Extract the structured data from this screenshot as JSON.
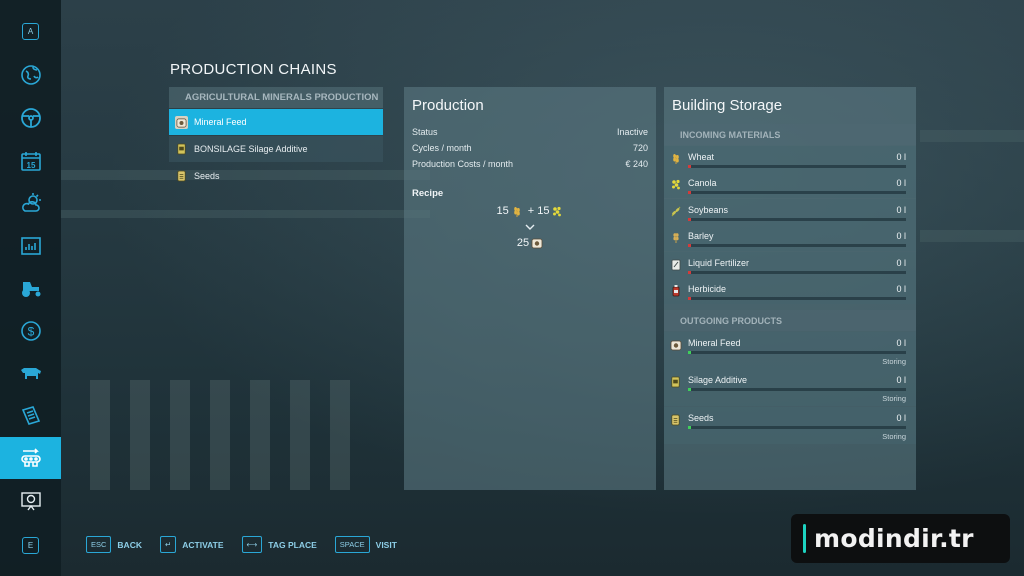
{
  "page": {
    "title": "PRODUCTION CHAINS"
  },
  "sidebar": {
    "top_key": "A",
    "bottom_key": "E",
    "items": [
      {
        "icon": "globe-icon"
      },
      {
        "icon": "steering-wheel-icon"
      },
      {
        "icon": "calendar-icon",
        "label": "15"
      },
      {
        "icon": "weather-icon"
      },
      {
        "icon": "statistics-icon"
      },
      {
        "icon": "tractor-icon"
      },
      {
        "icon": "finances-icon"
      },
      {
        "icon": "animals-icon"
      },
      {
        "icon": "contracts-icon"
      },
      {
        "icon": "production-chains-icon"
      },
      {
        "icon": "help-icon"
      }
    ]
  },
  "production_list": {
    "header": "AGRICULTURAL MINERALS PRODUCTION",
    "items": [
      {
        "label": "Mineral Feed",
        "icon": "mineral-feed-icon"
      },
      {
        "label": "BONSILAGE Silage Additive",
        "icon": "silage-additive-icon"
      },
      {
        "label": "Seeds",
        "icon": "seeds-icon"
      }
    ]
  },
  "production": {
    "title": "Production",
    "status_label": "Status",
    "status_value": "Inactive",
    "cycles_label": "Cycles / month",
    "cycles_value": "720",
    "costs_label": "Production Costs / month",
    "costs_value": "€ 240",
    "recipe_label": "Recipe",
    "recipe": {
      "input1_qty": "15",
      "input1_icon": "wheat-icon",
      "plus": "+",
      "input2_qty": "15",
      "input2_icon": "canola-icon",
      "output_qty": "25",
      "output_icon": "mineral-feed-icon"
    }
  },
  "storage": {
    "title": "Building Storage",
    "incoming_label": "INCOMING MATERIALS",
    "incoming": [
      {
        "name": "Wheat",
        "amount": "0 l",
        "icon": "wheat-icon",
        "fill": 0
      },
      {
        "name": "Canola",
        "amount": "0 l",
        "icon": "canola-icon",
        "fill": 0
      },
      {
        "name": "Soybeans",
        "amount": "0 l",
        "icon": "soybeans-icon",
        "fill": 0
      },
      {
        "name": "Barley",
        "amount": "0 l",
        "icon": "barley-icon",
        "fill": 0
      },
      {
        "name": "Liquid Fertilizer",
        "amount": "0 l",
        "icon": "liquid-fertilizer-icon",
        "fill": 0
      },
      {
        "name": "Herbicide",
        "amount": "0 l",
        "icon": "herbicide-icon",
        "fill": 0
      }
    ],
    "outgoing_label": "OUTGOING PRODUCTS",
    "outgoing": [
      {
        "name": "Mineral Feed",
        "amount": "0 l",
        "state": "Storing",
        "icon": "mineral-feed-icon",
        "fill": 0
      },
      {
        "name": "Silage Additive",
        "amount": "0 l",
        "state": "Storing",
        "icon": "silage-additive-icon",
        "fill": 0
      },
      {
        "name": "Seeds",
        "amount": "0 l",
        "state": "Storing",
        "icon": "seeds-icon",
        "fill": 0
      }
    ],
    "incoming_bar_color": "#d33b3b",
    "outgoing_bar_color": "#3fcf5a"
  },
  "footer": {
    "hints": [
      {
        "key": "ESC",
        "label": "BACK"
      },
      {
        "key": "↵",
        "label": "ACTIVATE"
      },
      {
        "key": "⟷",
        "label": "TAG PLACE"
      },
      {
        "key": "SPACE",
        "label": "VISIT"
      }
    ]
  },
  "watermark": {
    "text": "modindir.tr"
  },
  "colors": {
    "accent": "#1cb3e0",
    "panel": "#5f7d87",
    "hint": "#8ecfe8"
  }
}
